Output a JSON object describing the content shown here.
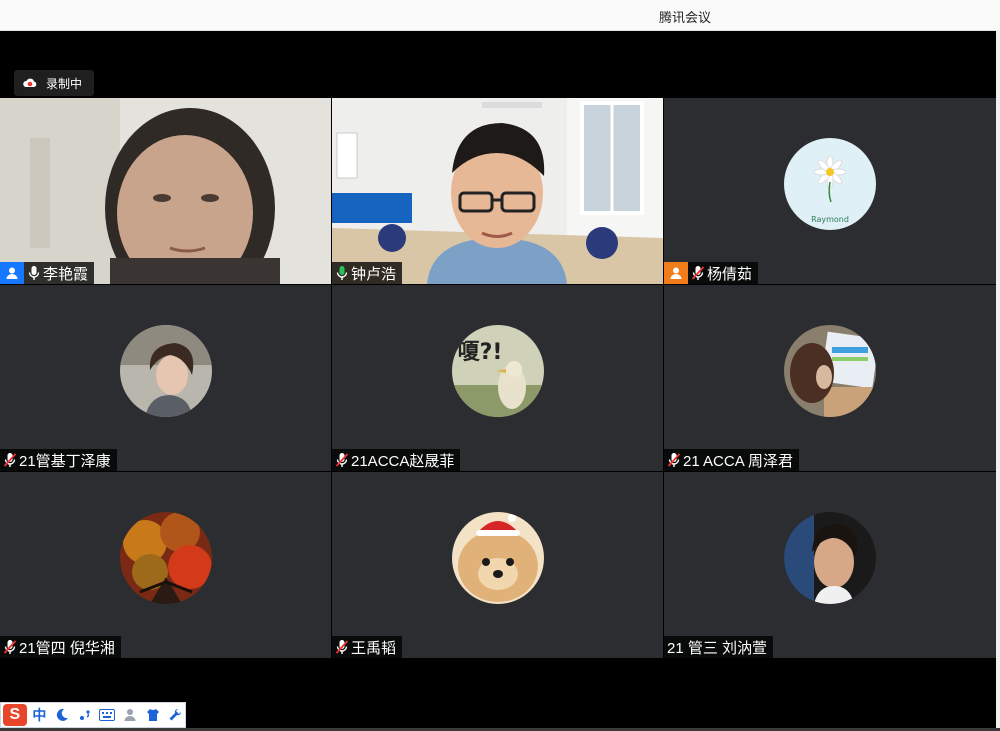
{
  "window": {
    "title": "腾讯会议"
  },
  "recording": {
    "label": "录制中"
  },
  "participants": [
    {
      "name": "李艳霞",
      "mic": "on",
      "role": "host",
      "view": "video"
    },
    {
      "name": "钟卢浩",
      "mic": "speaking",
      "role": "none",
      "view": "video"
    },
    {
      "name": "杨倩茹",
      "mic": "off",
      "role": "cohost",
      "view": "avatar",
      "avatar_text": "Raymond"
    },
    {
      "name": "21管基丁泽康",
      "mic": "off",
      "role": "none",
      "view": "avatar"
    },
    {
      "name": "21ACCA赵晟菲",
      "mic": "off",
      "role": "none",
      "view": "avatar",
      "avatar_text": "嗄?!"
    },
    {
      "name": "21 ACCA 周泽君",
      "mic": "off",
      "role": "none",
      "view": "avatar"
    },
    {
      "name": "21管四  倪华湘",
      "mic": "off",
      "role": "none",
      "view": "avatar"
    },
    {
      "name": "王禹韬",
      "mic": "off",
      "role": "none",
      "view": "avatar"
    },
    {
      "name": "21 管三 刘汭萱",
      "mic": "none",
      "role": "none",
      "view": "avatar"
    }
  ],
  "ime_toolbar": {
    "logo": "S",
    "items": [
      "中",
      "moon-icon",
      "punctuation-icon",
      "keyboard-icon",
      "user-icon",
      "shirt-icon",
      "wrench-icon"
    ],
    "mode_label": "中"
  },
  "colors": {
    "active_border": "#1fb85c",
    "tile_bg": "#2b2d31",
    "host_badge": "#1677ff",
    "cohost_badge": "#f07d1a",
    "mic_off": "#e33"
  }
}
